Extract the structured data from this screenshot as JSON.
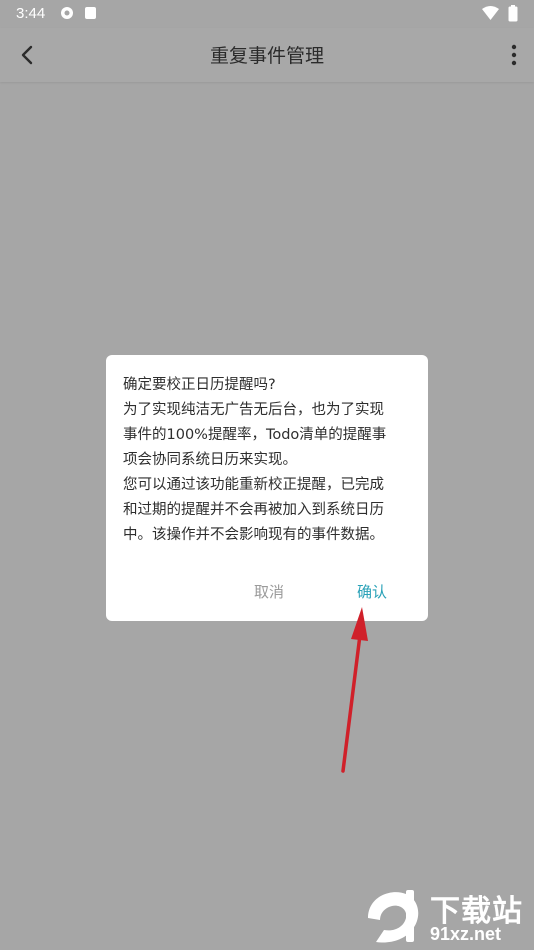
{
  "status_bar": {
    "time": "3:44"
  },
  "app_bar": {
    "title": "重复事件管理"
  },
  "dialog": {
    "lines": [
      "确定要校正日历提醒吗?",
      "为了实现纯洁无广告无后台，也为了实现",
      "事件的100%提醒率，Todo清单的提醒事",
      "项会协同系统日历来实现。",
      "您可以通过该功能重新校正提醒，已完成",
      "和过期的提醒并不会再被加入到系统日历",
      "中。该操作并不会影响现有的事件数据。"
    ],
    "cancel_label": "取消",
    "confirm_label": "确认"
  },
  "watermark": {
    "top_text": "下载站",
    "bottom_text": "91xz.net"
  },
  "colors": {
    "overlay_bg": "#a6a6a6",
    "accent": "#2aa2b8",
    "arrow": "#d0202a"
  }
}
